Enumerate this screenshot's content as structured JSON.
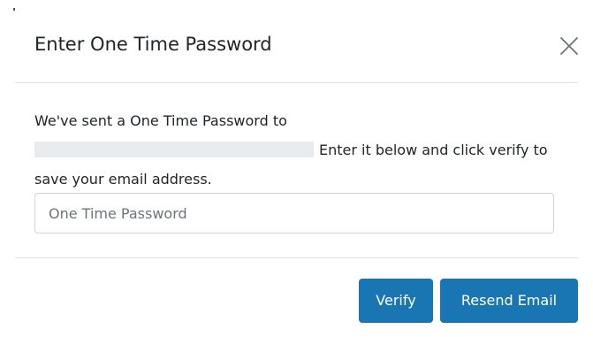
{
  "modal": {
    "title": "Enter One Time Password",
    "close_icon": "close-icon"
  },
  "body": {
    "message_prefix": "We've sent a One Time Password to",
    "email_redacted": "xxxxxxxxxxxxxxxxxxxxxxxxxxxxx",
    "message_suffix": "Enter it below and click verify to save your email address.",
    "otp_placeholder": "One Time Password",
    "otp_value": ""
  },
  "footer": {
    "verify_label": "Verify",
    "resend_label": "Resend Email"
  },
  "colors": {
    "primary_button": "#1976b2",
    "divider": "#dee2e6",
    "redaction": "#e9ecef"
  }
}
